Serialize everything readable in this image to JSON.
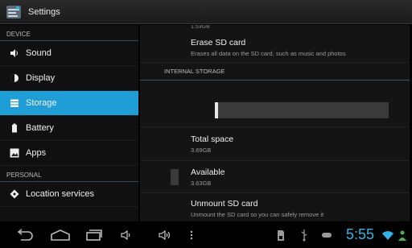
{
  "app": {
    "title": "Settings",
    "icon": "settings-icon"
  },
  "sidebar": {
    "sections": [
      {
        "header": "DEVICE"
      },
      {
        "header": "PERSONAL"
      }
    ],
    "items": [
      {
        "label": "Sound",
        "icon": "speaker-icon"
      },
      {
        "label": "Display",
        "icon": "display-icon"
      },
      {
        "label": "Storage",
        "icon": "storage-icon",
        "active": true
      },
      {
        "label": "Battery",
        "icon": "battery-icon"
      },
      {
        "label": "Apps",
        "icon": "apps-icon"
      },
      {
        "label": "Location services",
        "icon": "location-icon"
      }
    ],
    "active_color": "#1f9dd6"
  },
  "content": {
    "clipped_value": "1.53GB",
    "erase": {
      "title": "Erase SD card",
      "summary": "Erases all data on the SD card, such as music and photos"
    },
    "internal_header": "INTERNAL STORAGE",
    "used_fraction": 0.02,
    "total": {
      "title": "Total space",
      "value": "3.69GB"
    },
    "available": {
      "title": "Available",
      "value": "3.63GB"
    },
    "unmount": {
      "title": "Unmount SD card",
      "summary": "Unmount the SD card so you can safely remove it"
    }
  },
  "navbar": {
    "buttons": [
      "back-icon",
      "home-icon",
      "recent-apps-icon",
      "volume-down-icon",
      "volume-up-icon",
      "menu-icon"
    ],
    "status_icons": [
      "sd-card-icon",
      "usb-icon",
      "gamepad-icon",
      "wifi-icon",
      "battery-status-icon"
    ],
    "clock": "5:55",
    "accent": "#33b5e5"
  }
}
